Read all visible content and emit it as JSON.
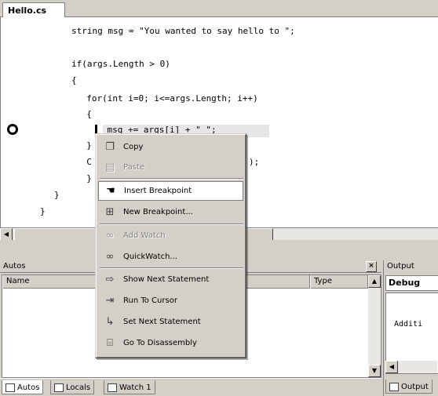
{
  "editor": {
    "tab_label": "Hello.cs",
    "code_lines": [
      "string msg = \"You wanted to say hello to \";",
      "",
      "if(args.Length > 0)",
      "{",
      "  for(int i=0; i<=args.Length; i++)",
      "  {",
      "    msg += args[i] + \" \";",
      "  }",
      "  C",
      "  }",
      "}",
      "}"
    ],
    "partial_right_text": ");"
  },
  "context_menu": {
    "items": [
      {
        "label": "Copy",
        "icon": "copy-icon",
        "state": "enabled"
      },
      {
        "label": "Paste",
        "icon": "paste-icon",
        "state": "disabled"
      },
      {
        "label": "Insert Breakpoint",
        "icon": "insert-breakpoint-icon",
        "state": "selected"
      },
      {
        "label": "New Breakpoint...",
        "icon": "new-breakpoint-icon",
        "state": "enabled"
      },
      {
        "label": "Add Watch",
        "icon": "add-watch-icon",
        "state": "disabled"
      },
      {
        "label": "QuickWatch...",
        "icon": "quickwatch-icon",
        "state": "enabled"
      },
      {
        "label": "Show Next Statement",
        "icon": "show-next-statement-icon",
        "state": "enabled"
      },
      {
        "label": "Run To Cursor",
        "icon": "run-to-cursor-icon",
        "state": "enabled"
      },
      {
        "label": "Set Next Statement",
        "icon": "set-next-statement-icon",
        "state": "enabled"
      },
      {
        "label": "Go To Disassembly",
        "icon": "go-to-disassembly-icon",
        "state": "enabled"
      }
    ]
  },
  "autos": {
    "title": "Autos",
    "columns": [
      "Name",
      "Type"
    ],
    "close_glyph": "×"
  },
  "bottom_tabs": [
    {
      "label": "Autos",
      "icon": "autos-tab-icon"
    },
    {
      "label": "Locals",
      "icon": "locals-tab-icon"
    },
    {
      "label": "Watch 1",
      "icon": "watch-tab-icon"
    }
  ],
  "output": {
    "title": "Output",
    "combo_value": "Debug",
    "text": "Additi",
    "tab_label": "Output"
  }
}
